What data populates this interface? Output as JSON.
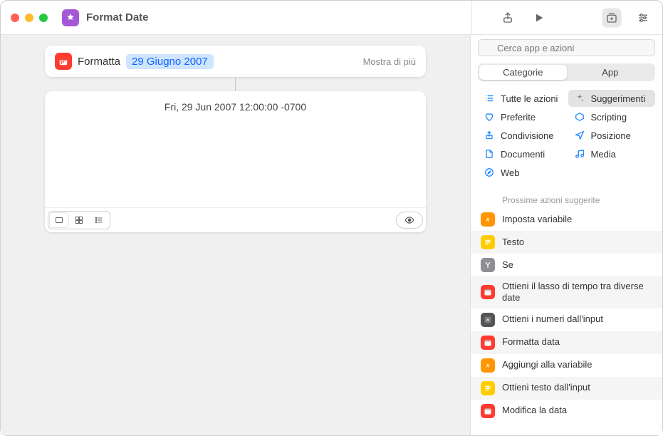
{
  "window": {
    "title": "Format Date"
  },
  "action": {
    "name": "Formatta",
    "token": "29 Giugno 2007",
    "more": "Mostra di più"
  },
  "result": {
    "text": "Fri, 29 Jun 2007 12:00:00 -0700"
  },
  "sidebar": {
    "search_placeholder": "Cerca app e azioni",
    "tabs": {
      "categories": "Categorie",
      "apps": "App"
    },
    "categories": {
      "all": "Tutte le azioni",
      "suggestions": "Suggerimenti",
      "favorites": "Preferite",
      "scripting": "Scripting",
      "sharing": "Condivisione",
      "location": "Posizione",
      "documents": "Documenti",
      "media": "Media",
      "web": "Web"
    },
    "section_label": "Prossime azioni suggerite",
    "suggestions": [
      {
        "label": "Imposta variabile",
        "color": "orange",
        "glyph": "x"
      },
      {
        "label": "Testo",
        "color": "yellow",
        "glyph": "≡"
      },
      {
        "label": "Se",
        "color": "gray",
        "glyph": "Y"
      },
      {
        "label": "Ottieni il lasso di tempo tra diverse date",
        "color": "red",
        "glyph": "cal"
      },
      {
        "label": "Ottieni i numeri dall'input",
        "color": "dark",
        "glyph": "#"
      },
      {
        "label": "Formatta data",
        "color": "red",
        "glyph": "cal"
      },
      {
        "label": "Aggiungi alla variabile",
        "color": "orange",
        "glyph": "x"
      },
      {
        "label": "Ottieni testo dall'input",
        "color": "yellow",
        "glyph": "≡"
      },
      {
        "label": "Modifica la data",
        "color": "red",
        "glyph": "cal"
      }
    ]
  }
}
